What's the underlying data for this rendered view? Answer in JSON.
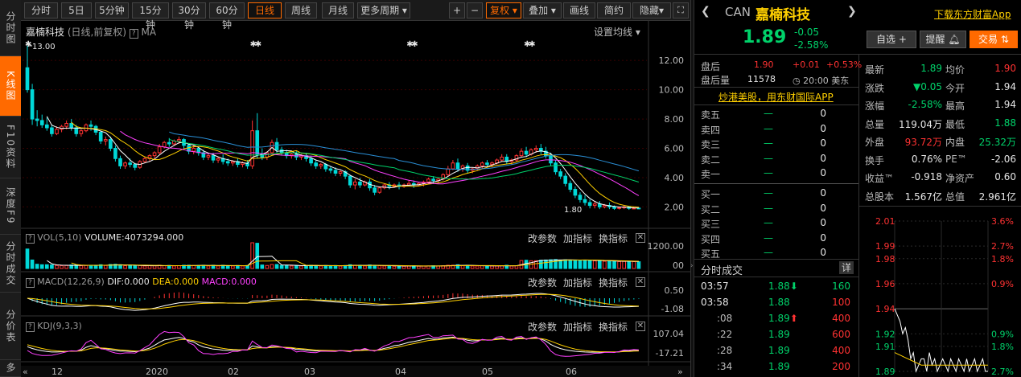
{
  "left_tabs": [
    {
      "label": "分时图",
      "active": false
    },
    {
      "label": "K线图",
      "active": true
    },
    {
      "label": "F10资料",
      "active": false
    },
    {
      "label": "深度F9",
      "active": false
    },
    {
      "label": "分时成交",
      "active": false
    },
    {
      "label": "分价表",
      "active": false
    },
    {
      "label": "多",
      "active": false
    }
  ],
  "toolbar": {
    "periods": [
      "分时",
      "5日",
      "5分钟",
      "15分钟",
      "30分钟",
      "60分钟",
      "日线",
      "周线",
      "月线",
      "更多周期"
    ],
    "active_period": "日线",
    "plus": "+",
    "minus": "−",
    "fuquan": "复权",
    "overlay": "叠加",
    "draw": "画线",
    "simple": "简约",
    "hide": "隐藏"
  },
  "chart_header": {
    "name": "嘉楠科技",
    "mode": "(日线,前复权)",
    "ma": "MA",
    "settings": "设置均线"
  },
  "panels": {
    "vol": {
      "label": "VOL(5,10)",
      "value_label": "VOLUME:4073294.000",
      "change": "改参数",
      "add": "加指标",
      "swap": "换指标"
    },
    "macd": {
      "label": "MACD(12,26,9)",
      "dif": "DIF:0.000",
      "dea": "DEA:0.000",
      "macd": "MACD:0.000",
      "change": "改参数",
      "add": "加指标",
      "swap": "换指标"
    },
    "kdj": {
      "label": "KDJ(9,3,3)",
      "change": "改参数",
      "add": "加指标",
      "swap": "换指标"
    }
  },
  "chart_data": {
    "type": "candlestick",
    "price_axis": [
      "12.00",
      "10.00",
      "8.00",
      "6.00",
      "4.00",
      "2.00"
    ],
    "ylim": [
      1.2,
      13.6
    ],
    "high_label": "13.00",
    "low_label": "1.80",
    "vol_axis": [
      "1200.00",
      "00"
    ],
    "macd_axis": [
      "0.50",
      "-1.08"
    ],
    "kdj_axis": [
      "107.04",
      "-17.21"
    ],
    "x_labels": [
      "12",
      "2020",
      "02",
      "03",
      "04",
      "05",
      "06"
    ],
    "ohlc": [
      [
        11.5,
        13.0,
        10.0,
        9.8
      ],
      [
        10.0,
        10.4,
        8.0,
        7.6
      ],
      [
        8.0,
        8.6,
        7.9,
        7.5
      ],
      [
        7.9,
        8.3,
        7.6,
        7.4
      ],
      [
        7.6,
        8.1,
        7.4,
        7.2
      ],
      [
        7.4,
        7.6,
        7.0,
        6.8
      ],
      [
        7.0,
        7.5,
        7.3,
        6.9
      ],
      [
        7.3,
        7.6,
        7.5,
        7.1
      ],
      [
        7.5,
        7.9,
        7.7,
        7.3
      ],
      [
        7.7,
        8.0,
        7.4,
        7.2
      ],
      [
        7.4,
        7.6,
        7.0,
        6.8
      ],
      [
        7.0,
        7.3,
        7.2,
        6.8
      ],
      [
        7.2,
        7.7,
        7.6,
        7.1
      ],
      [
        7.6,
        7.9,
        7.5,
        7.2
      ],
      [
        7.5,
        7.6,
        7.1,
        6.9
      ],
      [
        7.1,
        7.2,
        6.5,
        6.3
      ],
      [
        6.5,
        6.8,
        6.6,
        6.2
      ],
      [
        6.6,
        6.8,
        6.0,
        5.8
      ],
      [
        6.0,
        6.2,
        5.3,
        5.1
      ],
      [
        5.3,
        5.5,
        4.8,
        4.6
      ],
      [
        4.8,
        5.1,
        5.0,
        4.6
      ],
      [
        5.0,
        5.3,
        4.9,
        4.7
      ],
      [
        4.9,
        5.0,
        4.7,
        4.5
      ],
      [
        4.7,
        5.2,
        5.1,
        4.6
      ],
      [
        5.1,
        5.4,
        5.3,
        5.0
      ],
      [
        5.3,
        5.6,
        5.5,
        5.1
      ],
      [
        5.5,
        5.8,
        5.7,
        5.3
      ],
      [
        5.7,
        6.3,
        6.1,
        5.6
      ],
      [
        6.1,
        6.5,
        6.4,
        6.0
      ],
      [
        6.4,
        6.7,
        6.3,
        6.1
      ],
      [
        6.3,
        6.6,
        6.5,
        6.2
      ],
      [
        6.5,
        6.8,
        6.6,
        6.3
      ],
      [
        6.6,
        6.7,
        6.2,
        6.0
      ],
      [
        6.2,
        6.3,
        5.8,
        5.6
      ],
      [
        5.8,
        6.2,
        6.0,
        5.6
      ],
      [
        6.0,
        6.1,
        5.7,
        5.5
      ],
      [
        5.7,
        5.9,
        5.4,
        5.2
      ],
      [
        5.4,
        5.6,
        5.5,
        5.2
      ],
      [
        5.5,
        5.7,
        5.2,
        5.0
      ],
      [
        5.2,
        5.4,
        5.3,
        5.0
      ],
      [
        5.3,
        5.6,
        5.1,
        4.9
      ],
      [
        5.1,
        5.3,
        5.0,
        4.8
      ],
      [
        5.0,
        5.2,
        5.1,
        4.8
      ],
      [
        5.1,
        5.3,
        4.9,
        4.7
      ],
      [
        4.9,
        5.1,
        5.0,
        4.7
      ],
      [
        5.0,
        5.2,
        4.8,
        4.6
      ],
      [
        4.8,
        7.9,
        7.2,
        4.6
      ],
      [
        7.2,
        8.4,
        5.6,
        5.3
      ],
      [
        5.6,
        6.0,
        5.4,
        5.2
      ],
      [
        5.4,
        5.8,
        5.7,
        5.2
      ],
      [
        5.7,
        6.6,
        6.4,
        5.6
      ],
      [
        6.4,
        6.7,
        5.9,
        5.7
      ],
      [
        5.9,
        6.1,
        5.7,
        5.5
      ],
      [
        5.7,
        5.9,
        5.5,
        5.3
      ],
      [
        5.5,
        5.7,
        5.6,
        5.3
      ],
      [
        5.6,
        5.8,
        5.4,
        5.2
      ],
      [
        5.4,
        5.6,
        5.5,
        5.2
      ],
      [
        5.5,
        5.7,
        5.3,
        5.1
      ],
      [
        5.3,
        5.5,
        5.0,
        4.8
      ],
      [
        5.0,
        5.2,
        4.8,
        4.6
      ],
      [
        4.8,
        5.0,
        4.9,
        4.6
      ],
      [
        4.9,
        5.0,
        4.6,
        4.4
      ],
      [
        4.6,
        4.8,
        4.5,
        4.3
      ],
      [
        4.5,
        4.7,
        4.3,
        4.1
      ],
      [
        4.3,
        4.5,
        4.4,
        4.1
      ],
      [
        4.4,
        4.5,
        4.1,
        3.9
      ],
      [
        4.1,
        4.2,
        3.5,
        3.3
      ],
      [
        3.5,
        3.9,
        3.7,
        3.2
      ],
      [
        3.7,
        4.0,
        3.5,
        3.3
      ],
      [
        3.5,
        3.8,
        3.7,
        3.4
      ],
      [
        3.7,
        3.9,
        3.3,
        3.1
      ],
      [
        3.3,
        3.5,
        3.0,
        2.8
      ],
      [
        3.0,
        3.4,
        3.3,
        2.9
      ],
      [
        3.3,
        3.6,
        3.5,
        3.2
      ],
      [
        3.5,
        3.7,
        3.4,
        3.2
      ],
      [
        3.4,
        3.6,
        3.5,
        3.3
      ],
      [
        3.5,
        3.7,
        3.4,
        3.2
      ],
      [
        3.4,
        3.6,
        3.5,
        3.3
      ],
      [
        3.5,
        3.8,
        3.6,
        3.4
      ],
      [
        3.6,
        3.8,
        3.5,
        3.3
      ],
      [
        3.5,
        3.7,
        3.6,
        3.4
      ],
      [
        3.6,
        3.8,
        3.7,
        3.4
      ],
      [
        3.7,
        4.0,
        3.9,
        3.6
      ],
      [
        3.9,
        4.1,
        3.8,
        3.6
      ],
      [
        3.8,
        4.0,
        3.9,
        3.6
      ],
      [
        3.9,
        4.3,
        4.2,
        3.8
      ],
      [
        4.2,
        4.8,
        4.6,
        4.1
      ],
      [
        4.6,
        5.2,
        5.0,
        4.5
      ],
      [
        5.0,
        5.3,
        4.6,
        4.4
      ],
      [
        4.6,
        4.9,
        4.8,
        4.4
      ],
      [
        4.8,
        5.0,
        4.5,
        4.3
      ],
      [
        4.5,
        4.7,
        4.6,
        4.3
      ],
      [
        4.6,
        4.9,
        4.8,
        4.5
      ],
      [
        4.8,
        5.1,
        5.0,
        4.6
      ],
      [
        5.0,
        5.2,
        4.9,
        4.7
      ],
      [
        4.9,
        5.1,
        5.0,
        4.7
      ],
      [
        5.0,
        5.3,
        5.2,
        4.9
      ],
      [
        5.2,
        5.6,
        5.4,
        5.1
      ],
      [
        5.4,
        5.6,
        5.1,
        4.9
      ],
      [
        5.1,
        5.3,
        5.2,
        4.9
      ],
      [
        5.2,
        5.6,
        5.5,
        5.1
      ],
      [
        5.5,
        6.0,
        5.8,
        5.4
      ],
      [
        5.8,
        6.1,
        5.6,
        5.4
      ],
      [
        5.6,
        6.0,
        5.9,
        5.5
      ],
      [
        5.9,
        6.2,
        6.0,
        5.7
      ],
      [
        6.0,
        6.3,
        5.8,
        5.6
      ],
      [
        5.8,
        6.1,
        5.5,
        5.3
      ],
      [
        5.5,
        5.7,
        5.0,
        4.8
      ],
      [
        5.0,
        5.2,
        4.4,
        4.2
      ],
      [
        4.4,
        4.6,
        4.1,
        3.9
      ],
      [
        4.1,
        4.3,
        3.6,
        3.4
      ],
      [
        3.6,
        3.8,
        3.2,
        3.0
      ],
      [
        3.2,
        3.4,
        2.8,
        2.6
      ],
      [
        2.8,
        3.0,
        2.5,
        2.3
      ],
      [
        2.5,
        2.8,
        2.3,
        2.1
      ],
      [
        2.3,
        2.5,
        2.1,
        1.9
      ],
      [
        2.1,
        2.4,
        2.2,
        1.9
      ],
      [
        2.2,
        2.4,
        2.0,
        1.85
      ],
      [
        2.0,
        2.2,
        2.1,
        1.9
      ],
      [
        2.1,
        2.3,
        2.0,
        1.85
      ],
      [
        2.0,
        2.1,
        1.9,
        1.8
      ],
      [
        1.9,
        2.0,
        1.95,
        1.82
      ],
      [
        1.95,
        2.1,
        2.0,
        1.85
      ],
      [
        2.0,
        2.05,
        1.9,
        1.8
      ],
      [
        1.9,
        2.0,
        1.92,
        1.85
      ],
      [
        1.92,
        1.98,
        1.89,
        1.86
      ]
    ]
  },
  "quote": {
    "ticker": "CAN",
    "name": "嘉楠科技",
    "download": "下载东方财富App",
    "price": "1.89",
    "change": "-0.05",
    "pct": "-2.58%",
    "btn_watch": "自选",
    "btn_alert": "提醒",
    "btn_trade": "交易",
    "after_label": "盘后",
    "after_price": "1.90",
    "after_chg": "+0.01",
    "after_pct": "+0.53%",
    "after_vol_label": "盘后量",
    "after_vol": "11578",
    "after_time": "20:00 美东",
    "promo": "炒港美股，用东财国际APP"
  },
  "orderbook": [
    {
      "label": "卖五",
      "dash": "—",
      "vol": "0"
    },
    {
      "label": "卖四",
      "dash": "—",
      "vol": "0"
    },
    {
      "label": "卖三",
      "dash": "—",
      "vol": "0"
    },
    {
      "label": "卖二",
      "dash": "—",
      "vol": "0"
    },
    {
      "label": "卖一",
      "dash": "—",
      "vol": "0"
    },
    {
      "label": "买一",
      "dash": "—",
      "vol": "0"
    },
    {
      "label": "买二",
      "dash": "—",
      "vol": "0"
    },
    {
      "label": "买三",
      "dash": "—",
      "vol": "0"
    },
    {
      "label": "买四",
      "dash": "—",
      "vol": "0"
    },
    {
      "label": "买五",
      "dash": "—",
      "vol": "0"
    }
  ],
  "stats": [
    {
      "l1": "最新",
      "v1": "1.89",
      "c1": "green",
      "l2": "均价",
      "v2": "1.90",
      "c2": "red"
    },
    {
      "l1": "涨跌",
      "v1": "▼0.05",
      "c1": "green",
      "l2": "今开",
      "v2": "1.94",
      "c2": "white"
    },
    {
      "l1": "涨幅",
      "v1": "-2.58%",
      "c1": "green",
      "l2": "最高",
      "v2": "1.94",
      "c2": "white"
    },
    {
      "l1": "总量",
      "v1": "119.04万",
      "c1": "white",
      "l2": "最低",
      "v2": "1.88",
      "c2": "green"
    },
    {
      "l1": "外盘",
      "v1": "93.72万",
      "c1": "red",
      "l2": "内盘",
      "v2": "25.32万",
      "c2": "green"
    },
    {
      "l1": "换手",
      "v1": "0.76%",
      "c1": "white",
      "l2": "PE™",
      "v2": "-2.06",
      "c2": "white"
    },
    {
      "l1": "收益™",
      "v1": "-0.918",
      "c1": "white",
      "l2": "净资产",
      "v2": "0.60",
      "c2": "white"
    },
    {
      "l1": "总股本",
      "v1": "1.567亿",
      "c1": "white",
      "l2": "总值",
      "v2": "2.961亿",
      "c2": "white"
    }
  ],
  "trades_header": {
    "title": "分时成交",
    "detail": "详"
  },
  "trades": [
    {
      "time": "03:57",
      "price": "1.88",
      "arrow": "⬇",
      "vol": "160",
      "vc": "green"
    },
    {
      "time": "03:58",
      "price": "1.88",
      "arrow": "",
      "vol": "100",
      "vc": "red"
    },
    {
      "time": ":08",
      "price": "1.89",
      "arrow": "⬆",
      "vol": "400",
      "vc": "red"
    },
    {
      "time": ":22",
      "price": "1.89",
      "arrow": "",
      "vol": "600",
      "vc": "red"
    },
    {
      "time": ":28",
      "price": "1.89",
      "arrow": "",
      "vol": "400",
      "vc": "red"
    },
    {
      "time": ":34",
      "price": "1.89",
      "arrow": "",
      "vol": "200",
      "vc": "red"
    }
  ],
  "mini_chart": {
    "left_axis": [
      "2.01",
      "1.99",
      "1.98",
      "1.96",
      "1.94",
      "1.92",
      "1.91",
      "1.89"
    ],
    "right_axis": [
      "3.6%",
      "2.7%",
      "1.8%",
      "0.9%",
      "",
      "0.9%",
      "1.8%",
      "2.7%"
    ],
    "prices": [
      1.94,
      1.935,
      1.93,
      1.92,
      1.925,
      1.915,
      1.9,
      1.905,
      1.89,
      1.895,
      1.9,
      1.9,
      1.89,
      1.905,
      1.895,
      1.9,
      1.89,
      1.895,
      1.9,
      1.895,
      1.89,
      1.9,
      1.895,
      1.89,
      1.9,
      1.895,
      1.89,
      1.9,
      1.89,
      1.895,
      1.9,
      1.89,
      1.895,
      1.9,
      1.89,
      1.89
    ]
  },
  "colors": {
    "up": "#ff3232",
    "down": "#00d8d8",
    "ma5": "#ffffff",
    "ma10": "#ffd000",
    "ma20": "#ff40ff",
    "ma30": "#00d26a",
    "ma60": "#2a8fd6",
    "orange": "#ff6a00"
  }
}
